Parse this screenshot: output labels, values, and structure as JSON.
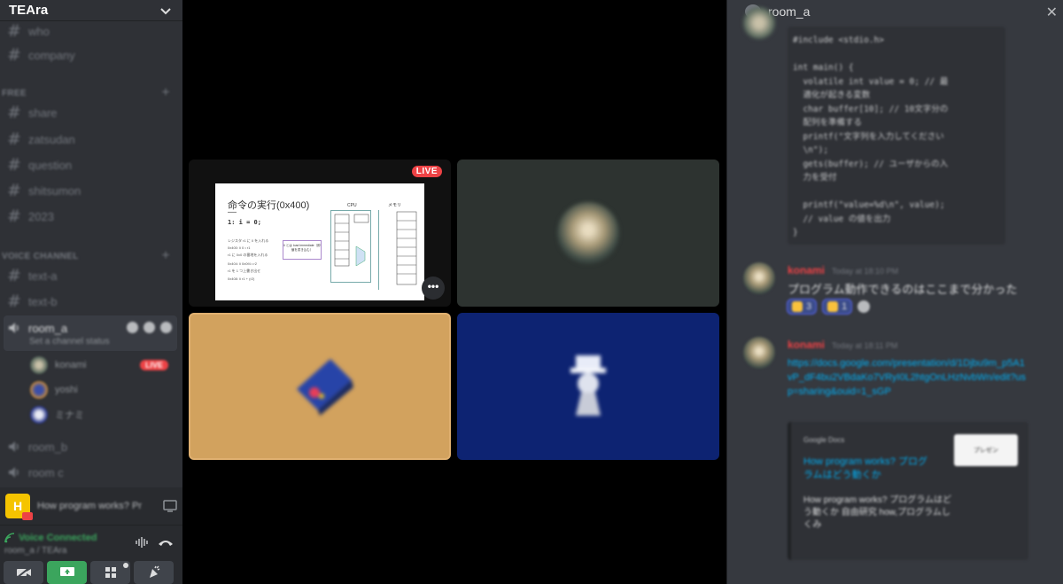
{
  "server": {
    "name": "TEAra"
  },
  "sidebar": {
    "top_channels": [
      "who",
      "company"
    ],
    "category_free": "FREE",
    "free_channels": [
      "share",
      "zatsudan",
      "question",
      "shitsumon",
      "2023"
    ],
    "category_voice": "VOICE CHANNEL",
    "text_channels": [
      "text-a",
      "text-b"
    ],
    "active_room": "room_a",
    "active_room_status": "Set a channel status",
    "voice_users": [
      {
        "name": "konami",
        "live": "LIVE"
      },
      {
        "name": "yoshi",
        "live": ""
      },
      {
        "name": "ミナミ",
        "live": ""
      }
    ],
    "other_rooms": [
      "room_b",
      "room c"
    ]
  },
  "stream": {
    "badge": "H",
    "title": "How program works? Pr"
  },
  "voice_panel": {
    "status": "Voice Connected",
    "channel": "room_a / TEAra"
  },
  "stage": {
    "live_label": "LIVE",
    "more_label": "•••",
    "slide": {
      "title": "命令の実行(0x400)",
      "code": "1: i = 0;",
      "lines": [
        "レジスタ r1 に 0 を入れる",
        "0x400: li 0 • r1",
        "r1 に 0x0 の番地を入れる",
        "0x404: li 0x0f4 • r2",
        "r1 を 1 つ上書き出せ",
        "0x408: li r1 + (r2)"
      ],
      "note": "li とは load immediate（即値を書き込む）",
      "cpu_label": "CPU",
      "mem_label": "メモリ"
    }
  },
  "chat": {
    "channel_name": "room_a",
    "close_label": "✕",
    "code_lines": [
      "#include <stdio.h>",
      "",
      "int main() {",
      "  volatile int value = 0; // 最",
      "  適化が起きる変数",
      "  char buffer[10]; // 10文字分の",
      "  配列を準備する",
      "  printf(\"文字列を入力してください",
      "  \\n\");",
      "  gets(buffer); // ユーザからの入",
      "  力を受付",
      "",
      "  printf(\"value=%d\\n\", value);",
      "  // value の値を出力",
      "}"
    ],
    "messages": [
      {
        "name": "konami",
        "time": "Today at 18:10 PM",
        "text": "プログラム動作できるのはここまで分かった"
      },
      {
        "name": "konami",
        "time": "Today at 18:11 PM",
        "link": "https://docs.google.com/presentation/d/1Djbu9m_p5A1vP_dF4bu2VBdaKo7VRyI0L2htgOnLHzNvbWn/edit?usp=sharing&ouid=1_sGP"
      }
    ],
    "reactions": [
      {
        "emoji": "thumbs-up",
        "count": "3"
      },
      {
        "emoji": "confetti",
        "count": "1"
      }
    ],
    "embed": {
      "provider": "Google Docs",
      "title": "How program works? プログラムはどう動くか",
      "desc": "How program works? プログラムはどう動くか 自由研究 how,プログラムしくみ",
      "thumb_label": "プレゼン"
    }
  },
  "colors": {
    "live": "#ed4245",
    "voice_connected": "#3ba55d",
    "link": "#00aff4",
    "username": "#ed4245"
  }
}
